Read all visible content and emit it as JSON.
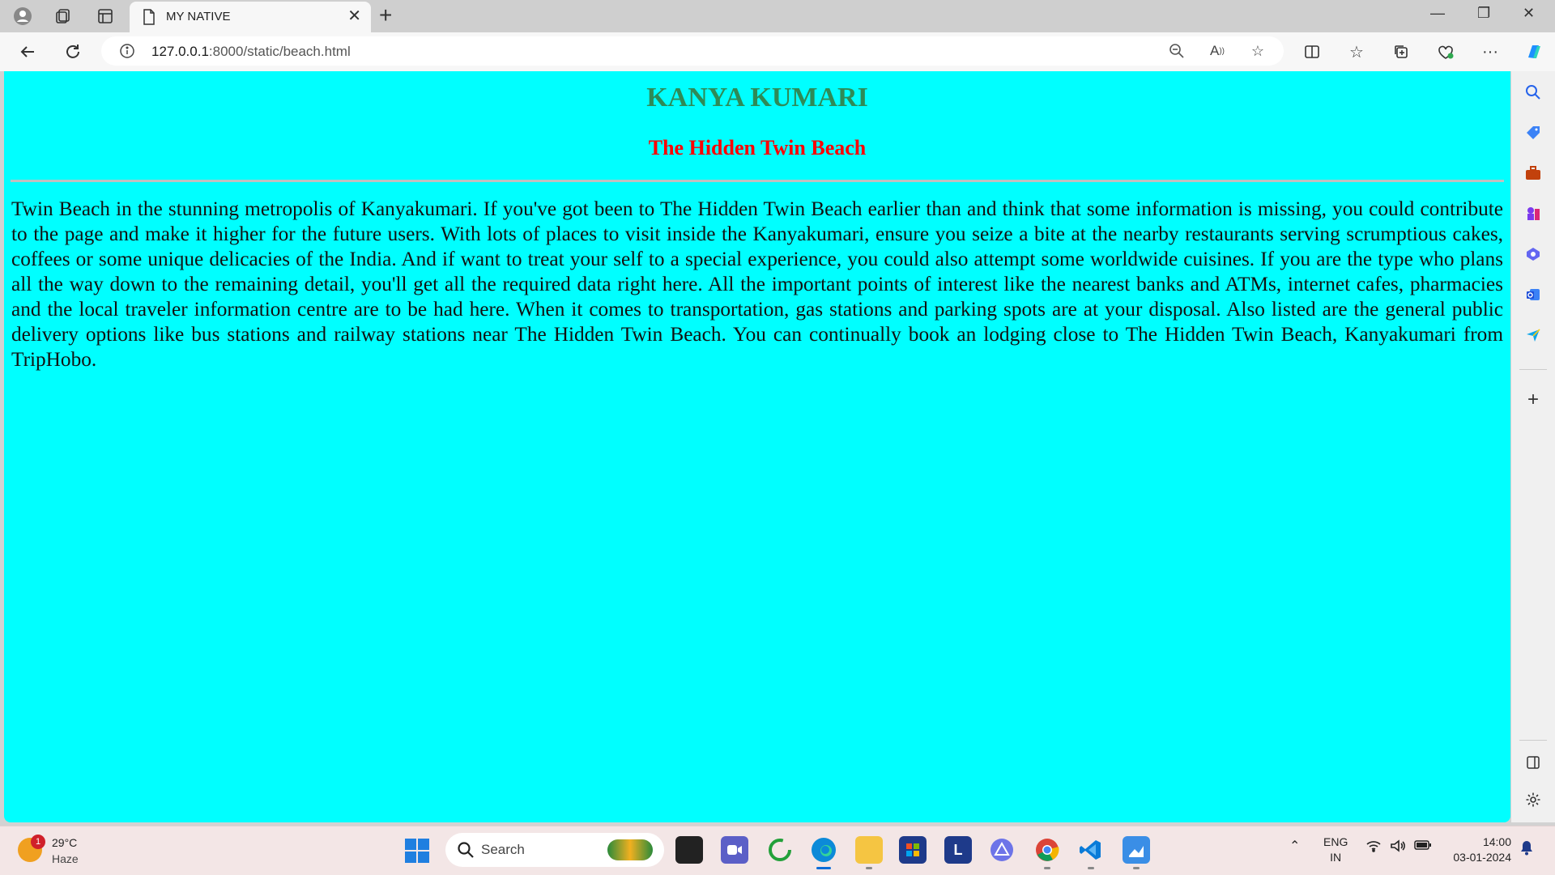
{
  "browser": {
    "tab_title": "MY NATIVE",
    "url_host": "127.0.0.1",
    "url_rest": ":8000/static/beach.html"
  },
  "page": {
    "heading": "KANYA KUMARI",
    "subheading": "The Hidden Twin Beach",
    "paragraph": "Twin Beach in the stunning metropolis of Kanyakumari. If you've got been to The Hidden Twin Beach earlier than and think that some information is missing, you could contribute to the page and make it higher for the future users. With lots of places to visit inside the Kanyakumari, ensure you seize a bite at the nearby restaurants serving scrumptious cakes, coffees or some unique delicacies of the India. And if want to treat your self to a special experience, you could also attempt some worldwide cuisines. If you are the type who plans all the way down to the remaining detail, you'll get all the required data right here. All the important points of interest like the nearest banks and ATMs, internet cafes, pharmacies and the local traveler information centre are to be had here. When it comes to transportation, gas stations and parking spots are at your disposal. Also listed are the general public delivery options like bus stations and railway stations near The Hidden Twin Beach. You can continually book an lodging close to The Hidden Twin Beach, Kanyakumari from TripHobo.",
    "background_color": "#00ffff",
    "heading_color": "#2e8b57",
    "subheading_color": "#ff0000"
  },
  "taskbar": {
    "weather_badge": "1",
    "weather_temp": "29°C",
    "weather_desc": "Haze",
    "search_placeholder": "Search",
    "lang_line1": "ENG",
    "lang_line2": "IN",
    "time": "14:00",
    "date": "03-01-2024",
    "app_letter_l": "L"
  }
}
